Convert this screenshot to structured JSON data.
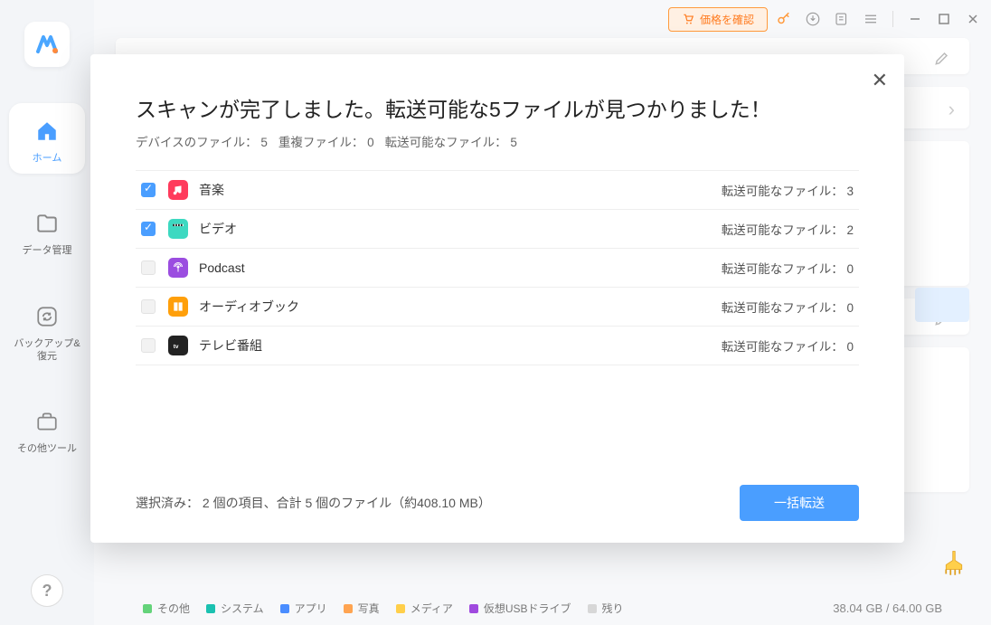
{
  "titlebar": {
    "price_label": "価格を確認"
  },
  "sidebar": {
    "items": [
      {
        "label": "ホーム"
      },
      {
        "label": "データ管理"
      },
      {
        "label": "バックアップ&\n復元"
      },
      {
        "label": "その他ツール"
      }
    ]
  },
  "modal": {
    "title": "スキャンが完了しました。転送可能な5ファイルが見つかりました！",
    "sub_device": "デバイスのファイル： 5",
    "sub_dupe": "重複ファイル： 0",
    "sub_transferable": "転送可能なファイル： 5",
    "count_label": "転送可能なファイル：",
    "rows": [
      {
        "label": "音楽",
        "count": "3",
        "checked": true,
        "icon_bg": "#ff3b5c"
      },
      {
        "label": "ビデオ",
        "count": "2",
        "checked": true,
        "icon_bg": "#3dd9c1"
      },
      {
        "label": "Podcast",
        "count": "0",
        "checked": false,
        "icon_bg": "#9b4de0"
      },
      {
        "label": "オーディオブック",
        "count": "0",
        "checked": false,
        "icon_bg": "#ff9f0a"
      },
      {
        "label": "テレビ番組",
        "count": "0",
        "checked": false,
        "icon_bg": "#222"
      }
    ],
    "summary": "選択済み： 2 個の項目、合計 5 個のファイル（約408.10 MB）",
    "transfer_btn": "一括転送"
  },
  "storage": {
    "legend": [
      {
        "label": "その他",
        "color": "#64d37a"
      },
      {
        "label": "システム",
        "color": "#1bc1b0"
      },
      {
        "label": "アプリ",
        "color": "#4a8dff"
      },
      {
        "label": "写真",
        "color": "#ffa451"
      },
      {
        "label": "メディア",
        "color": "#ffcf4a"
      },
      {
        "label": "仮想USBドライブ",
        "color": "#a04adf"
      },
      {
        "label": "残り",
        "color": "#d7d7d7"
      }
    ],
    "text": "38.04 GB / 64.00 GB"
  }
}
